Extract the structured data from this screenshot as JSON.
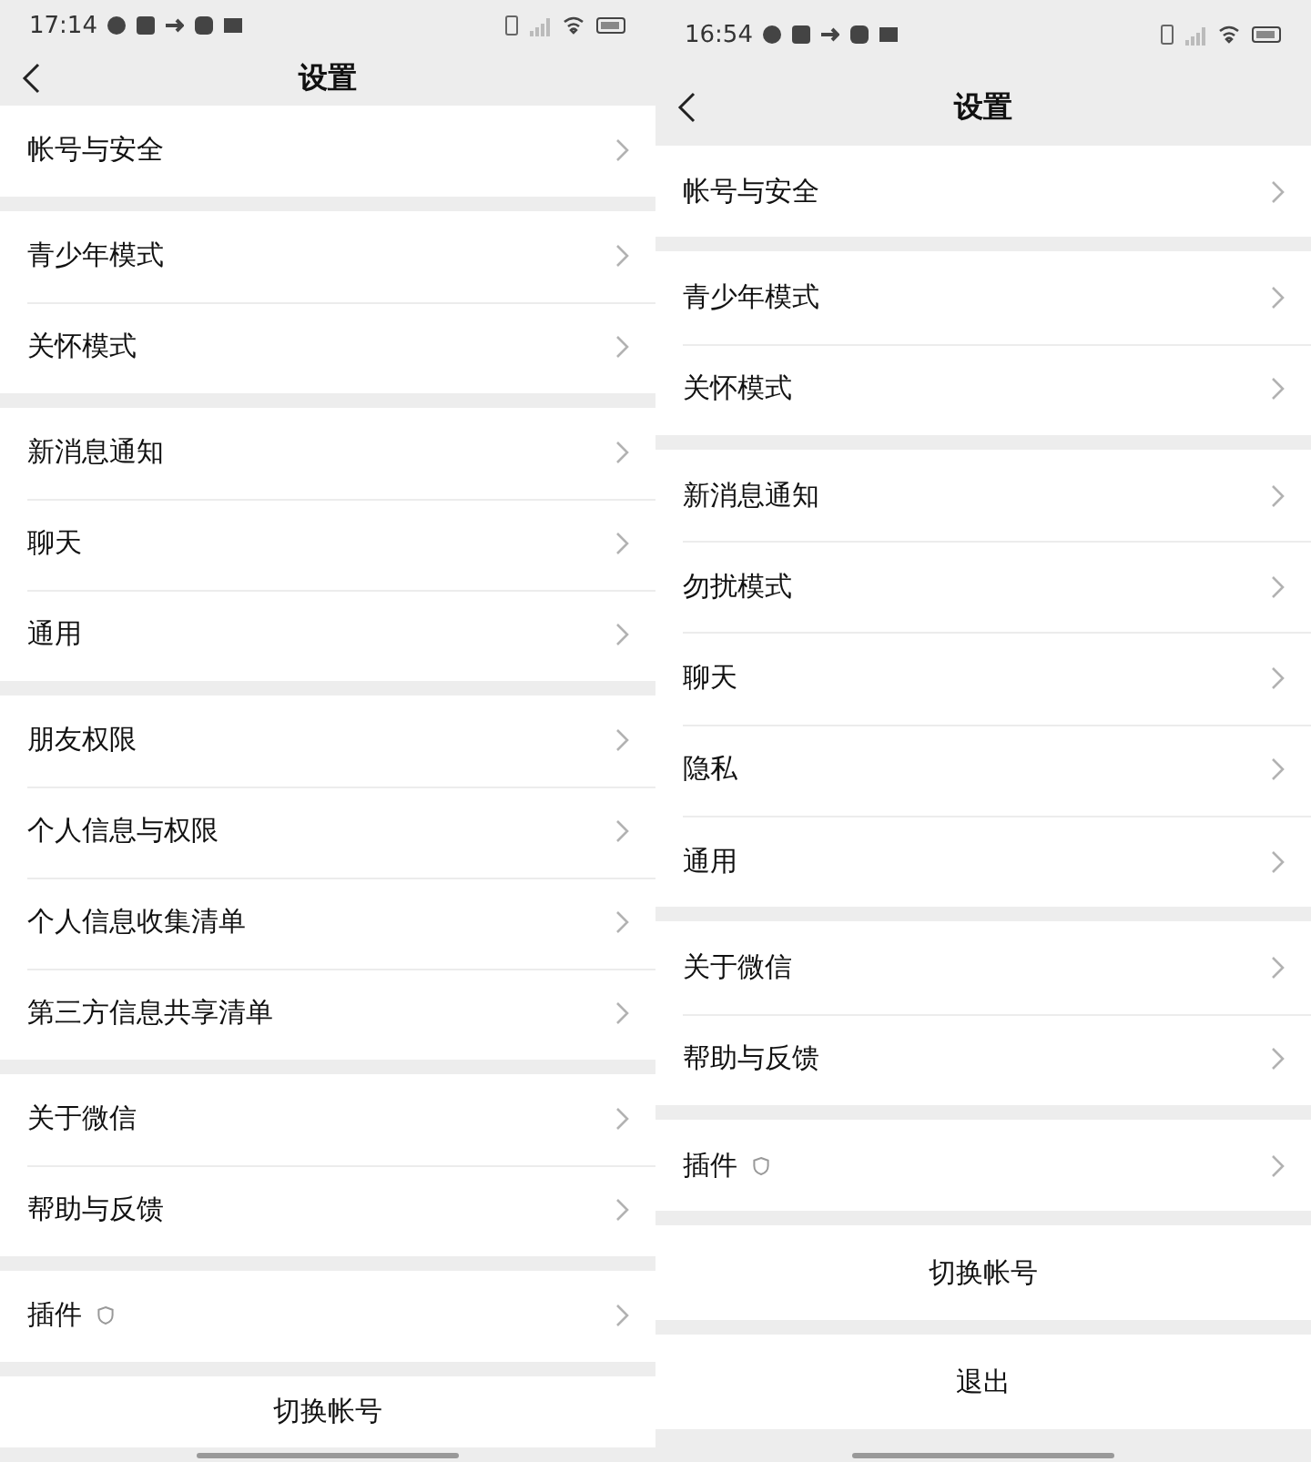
{
  "phones": [
    {
      "status_time": "17:14",
      "title": "设置",
      "groups": [
        [
          {
            "label": "帐号与安全",
            "kind": "link"
          }
        ],
        [
          {
            "label": "青少年模式",
            "kind": "link"
          },
          {
            "label": "关怀模式",
            "kind": "link"
          }
        ],
        [
          {
            "label": "新消息通知",
            "kind": "link"
          },
          {
            "label": "聊天",
            "kind": "link"
          },
          {
            "label": "通用",
            "kind": "link"
          }
        ],
        [
          {
            "label": "朋友权限",
            "kind": "link"
          },
          {
            "label": "个人信息与权限",
            "kind": "link"
          },
          {
            "label": "个人信息收集清单",
            "kind": "link"
          },
          {
            "label": "第三方信息共享清单",
            "kind": "link"
          }
        ],
        [
          {
            "label": "关于微信",
            "kind": "link"
          },
          {
            "label": "帮助与反馈",
            "kind": "link"
          }
        ],
        [
          {
            "label": "插件",
            "kind": "plugin"
          }
        ]
      ],
      "actions": [
        "切换帐号"
      ]
    },
    {
      "status_time": "16:54",
      "title": "设置",
      "groups": [
        [
          {
            "label": "帐号与安全",
            "kind": "link"
          }
        ],
        [
          {
            "label": "青少年模式",
            "kind": "link"
          },
          {
            "label": "关怀模式",
            "kind": "link"
          }
        ],
        [
          {
            "label": "新消息通知",
            "kind": "link"
          },
          {
            "label": "勿扰模式",
            "kind": "link"
          },
          {
            "label": "聊天",
            "kind": "link"
          },
          {
            "label": "隐私",
            "kind": "link"
          },
          {
            "label": "通用",
            "kind": "link"
          }
        ],
        [
          {
            "label": "关于微信",
            "kind": "link"
          },
          {
            "label": "帮助与反馈",
            "kind": "link"
          }
        ],
        [
          {
            "label": "插件",
            "kind": "plugin"
          }
        ]
      ],
      "actions": [
        "切换帐号",
        "退出"
      ]
    }
  ]
}
